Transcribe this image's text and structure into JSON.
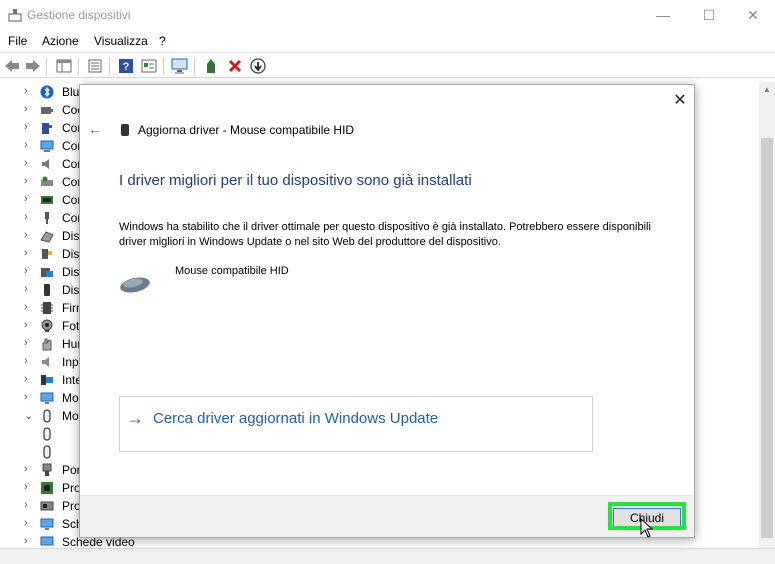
{
  "window": {
    "title": "Gestione dispositivi",
    "minimize": "—",
    "maximize": "☐",
    "close": "✕"
  },
  "menu": [
    "File",
    "Azione",
    "Visualizza",
    "?"
  ],
  "tree": [
    {
      "label": "Blu",
      "arrow": "›",
      "icon": "bluetooth-icon"
    },
    {
      "label": "Coc",
      "arrow": "›",
      "icon": "audio-input-icon"
    },
    {
      "label": "Cor",
      "arrow": "›",
      "icon": "controller-icon"
    },
    {
      "label": "Cor",
      "arrow": "›",
      "icon": "computer-icon"
    },
    {
      "label": "Cor",
      "arrow": "›",
      "icon": "sound-icon"
    },
    {
      "label": "Cor",
      "arrow": "›",
      "icon": "storage-controller-icon"
    },
    {
      "label": "Cor",
      "arrow": "›",
      "icon": "ide-controller-icon"
    },
    {
      "label": "Cor",
      "arrow": "›",
      "icon": "usb-controller-icon"
    },
    {
      "label": "Disp",
      "arrow": "›",
      "icon": "disk-drive-icon"
    },
    {
      "label": "Disp",
      "arrow": "›",
      "icon": "security-device-icon"
    },
    {
      "label": "Disp",
      "arrow": "›",
      "icon": "software-device-icon"
    },
    {
      "label": "Disp",
      "arrow": "›",
      "icon": "portable-device-icon"
    },
    {
      "label": "Firm",
      "arrow": "›",
      "icon": "firmware-icon"
    },
    {
      "label": "Foto",
      "arrow": "›",
      "icon": "camera-icon"
    },
    {
      "label": "Hun",
      "arrow": "›",
      "icon": "hid-icon"
    },
    {
      "label": "Inp",
      "arrow": "›",
      "icon": "keyboard-icon"
    },
    {
      "label": "Inte",
      "arrow": "›",
      "icon": "network-icon"
    },
    {
      "label": "Mo",
      "arrow": "›",
      "icon": "monitor-icon"
    },
    {
      "label": "Mo",
      "arrow": "⌄",
      "icon": "mouse-icon"
    },
    {
      "label": "",
      "arrow": "",
      "icon": "mouse-icon",
      "child": true
    },
    {
      "label": "",
      "arrow": "",
      "icon": "mouse-icon",
      "child": true
    },
    {
      "label": "Por",
      "arrow": "›",
      "icon": "port-icon"
    },
    {
      "label": "Pro",
      "arrow": "›",
      "icon": "processor-icon"
    },
    {
      "label": "Pro",
      "arrow": "›",
      "icon": "processor-icon"
    },
    {
      "label": "Sche",
      "arrow": "›",
      "icon": "display-adapter-icon"
    },
    {
      "label": "Schede video",
      "arrow": "›",
      "icon": "display-adapter-icon"
    }
  ],
  "dialog": {
    "close": "✕",
    "back": "←",
    "header": "Aggiorna driver - Mouse compatibile HID",
    "title": "I driver migliori per il tuo dispositivo sono già installati",
    "description": "Windows ha stabilito che il driver ottimale per questo dispositivo è già installato. Potrebbero essere disponibili driver migliori in Windows Update o nel sito Web del produttore del dispositivo.",
    "device_name": "Mouse compatibile HID",
    "link_arrow": "→",
    "link_text": "Cerca driver aggiornati in Windows Update",
    "close_button": "Chiudi"
  },
  "colors": {
    "accent": "#1f3c88",
    "link": "#1f5fb4",
    "highlight": "#22e53a"
  }
}
